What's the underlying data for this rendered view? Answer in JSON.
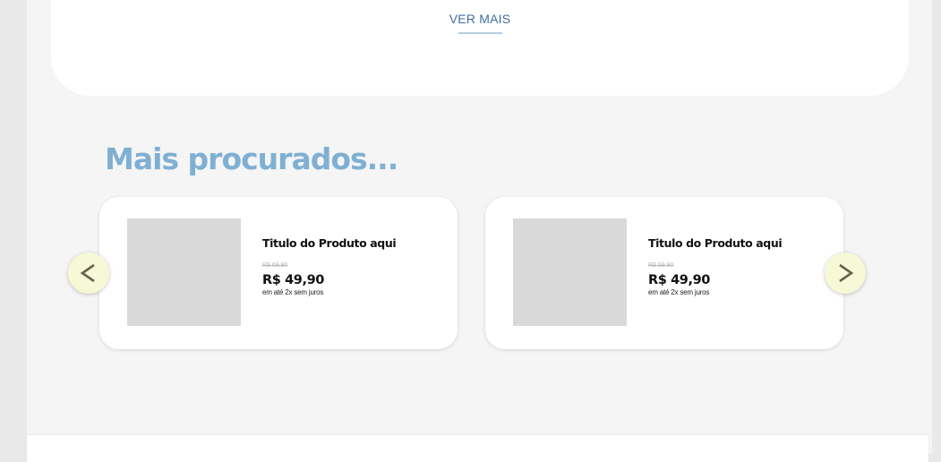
{
  "top_card": {
    "link_label": "VER MAIS"
  },
  "section": {
    "title": "Mais procurados..."
  },
  "products": [
    {
      "title": "Titulo do Produto aqui",
      "old_price": "R$ 69,90",
      "price": "R$ 49,90",
      "installments": "em até 2x sem juros"
    },
    {
      "title": "Titulo do Produto aqui",
      "old_price": "R$ 69,90",
      "price": "R$ 49,90",
      "installments": "em até 2x sem juros"
    }
  ],
  "carousel": {
    "prev_icon": "chevron-left-icon",
    "next_icon": "chevron-right-icon"
  },
  "colors": {
    "title": "#7fb0d3",
    "link": "#3f6ea3",
    "arrow_bg": "#f6f8d6",
    "arrow_glyph": "#6a6050",
    "image_placeholder": "#d9d9d9"
  }
}
